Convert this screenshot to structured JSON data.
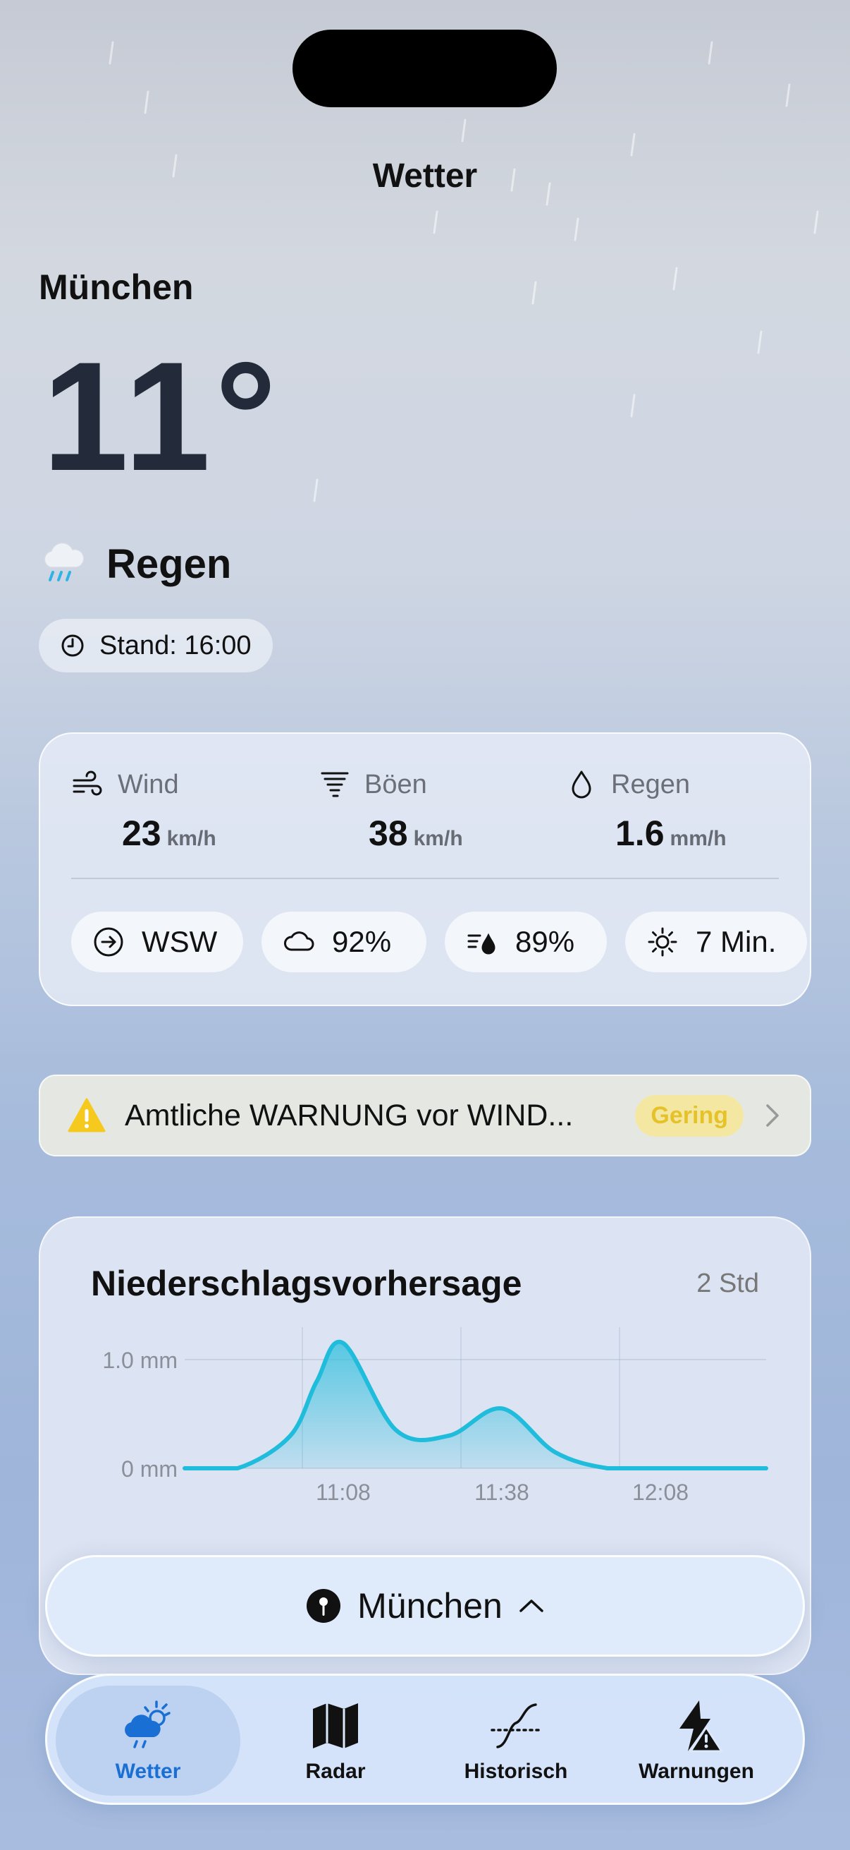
{
  "app_title": "Wetter",
  "current": {
    "city": "München",
    "temperature": "11°",
    "condition": "Regen",
    "condition_icon": "cloud-rain-icon",
    "stand": "Stand: 16:00"
  },
  "metrics": {
    "wind": {
      "label": "Wind",
      "value": "23",
      "unit": "km/h"
    },
    "gusts": {
      "label": "Böen",
      "value": "38",
      "unit": "km/h"
    },
    "rain": {
      "label": "Regen",
      "value": "1.6",
      "unit": "mm/h"
    },
    "chips": {
      "direction": "WSW",
      "cloud_cover": "92%",
      "humidity": "89%",
      "sunshine": "7 Min."
    }
  },
  "warning": {
    "text": "Amtliche WARNUNG vor WIND...",
    "level": "Gering",
    "badge_color": "#e6c22a"
  },
  "precipitation": {
    "title": "Niederschlagsvorhersage",
    "range": "2 Std"
  },
  "chart_data": {
    "type": "area",
    "x": [
      "10:38",
      "10:48",
      "10:58",
      "11:03",
      "11:08",
      "11:18",
      "11:28",
      "11:38",
      "11:48",
      "11:58",
      "12:08",
      "12:18",
      "12:28"
    ],
    "y": [
      0,
      0,
      0.3,
      0.8,
      1.15,
      0.35,
      0.3,
      0.55,
      0.15,
      0,
      0,
      0,
      0
    ],
    "ylabel_ticks": [
      "0 mm",
      "1.0 mm"
    ],
    "xtick_labels": [
      "11:08",
      "11:38",
      "12:08"
    ],
    "ylim": [
      0,
      1.2
    ],
    "color": "#1fbcdc"
  },
  "location_bar": {
    "city": "München"
  },
  "tabs": [
    {
      "label": "Wetter",
      "icon": "sun-cloud-rain-icon",
      "active": true
    },
    {
      "label": "Radar",
      "icon": "map-icon",
      "active": false
    },
    {
      "label": "Historisch",
      "icon": "chart-curve-icon",
      "active": false
    },
    {
      "label": "Warnungen",
      "icon": "lightning-warning-icon",
      "active": false
    }
  ],
  "accent_color": "#1a6fd4"
}
